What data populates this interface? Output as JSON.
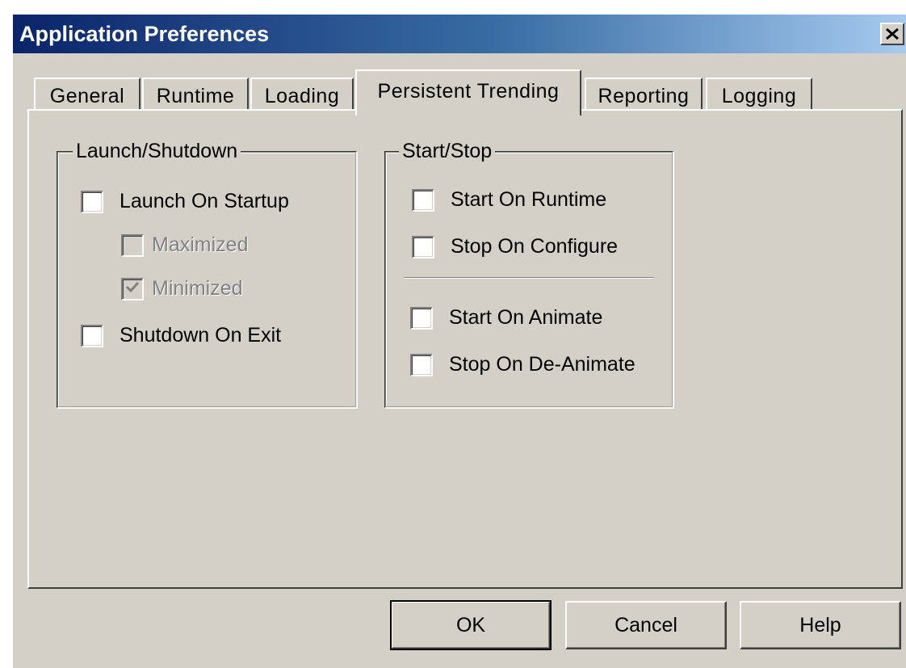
{
  "window": {
    "title": "Application Preferences",
    "close_icon": "close-icon"
  },
  "tabs": [
    {
      "label": "General",
      "active": false
    },
    {
      "label": "Runtime",
      "active": false
    },
    {
      "label": "Loading",
      "active": false
    },
    {
      "label": "Persistent Trending",
      "active": true
    },
    {
      "label": "Reporting",
      "active": false
    },
    {
      "label": "Logging",
      "active": false
    }
  ],
  "launch_shutdown": {
    "title": "Launch/Shutdown",
    "launch_on_startup": {
      "label": "Launch On Startup",
      "checked": false,
      "enabled": true
    },
    "maximized": {
      "label": "Maximized",
      "checked": false,
      "enabled": false
    },
    "minimized": {
      "label": "Minimized",
      "checked": true,
      "enabled": false
    },
    "shutdown_on_exit": {
      "label": "Shutdown On Exit",
      "checked": false,
      "enabled": true
    }
  },
  "start_stop": {
    "title": "Start/Stop",
    "start_on_runtime": {
      "label": "Start On Runtime",
      "checked": false,
      "enabled": true
    },
    "stop_on_configure": {
      "label": "Stop On Configure",
      "checked": false,
      "enabled": true
    },
    "start_on_animate": {
      "label": "Start On Animate",
      "checked": false,
      "enabled": true
    },
    "stop_on_deanimate": {
      "label": "Stop On De-Animate",
      "checked": false,
      "enabled": true
    }
  },
  "buttons": {
    "ok": "OK",
    "cancel": "Cancel",
    "help": "Help"
  },
  "colors": {
    "title_bar_start": "#0a246a",
    "title_bar_end": "#a6caf0",
    "face": "#d4d0c8",
    "disabled_text": "#808080"
  }
}
